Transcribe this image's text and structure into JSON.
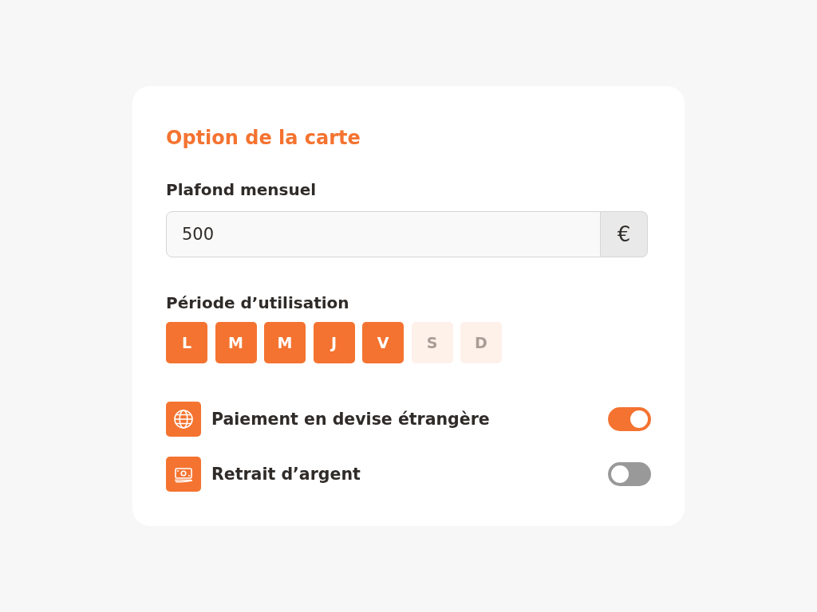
{
  "card": {
    "title": "Option de la carte"
  },
  "monthly_limit": {
    "label": "Plafond mensuel",
    "value": "500",
    "currency": "€"
  },
  "usage_period": {
    "label": "Période d’utilisation",
    "days": [
      {
        "label": "L",
        "selected": true
      },
      {
        "label": "M",
        "selected": true
      },
      {
        "label": "M",
        "selected": true
      },
      {
        "label": "J",
        "selected": true
      },
      {
        "label": "V",
        "selected": true
      },
      {
        "label": "S",
        "selected": false
      },
      {
        "label": "D",
        "selected": false
      }
    ]
  },
  "options": [
    {
      "label": "Paiement en devise étrangère",
      "on": true
    },
    {
      "label": "Retrait d’argent",
      "on": false
    }
  ]
}
